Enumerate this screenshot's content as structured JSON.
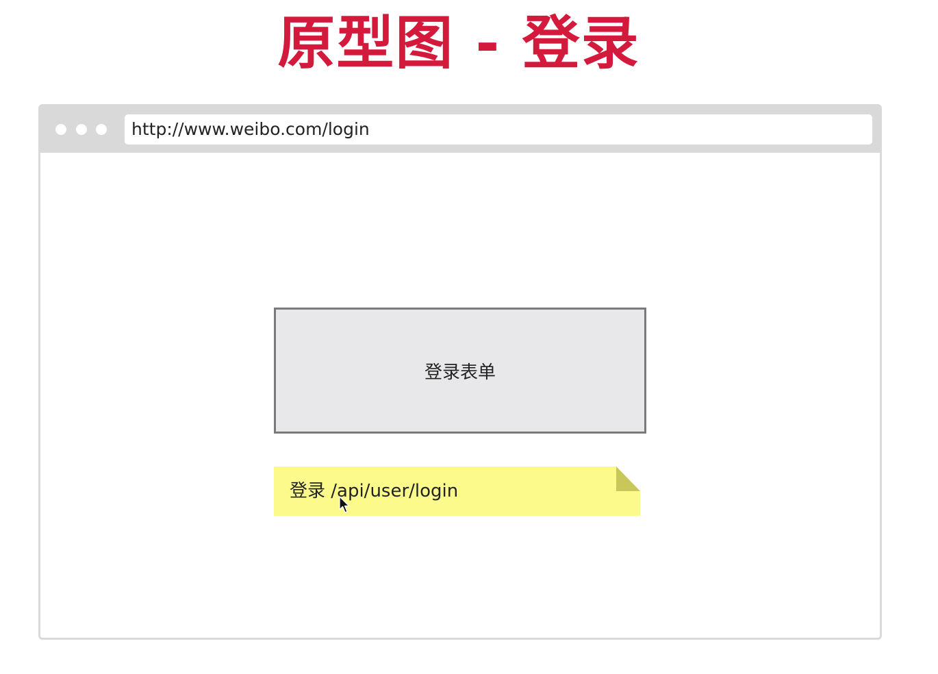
{
  "slide": {
    "title": "原型图 - 登录",
    "title_color": "#d41a3c"
  },
  "browser": {
    "url": "http://www.weibo.com/login",
    "window_dots": [
      "dot",
      "dot",
      "dot"
    ]
  },
  "main": {
    "form_box_label": "登录表单",
    "note": {
      "text": "登录 /api/user/login",
      "color": "#fbfa8b"
    }
  },
  "icons": {
    "cursor": "mouse-pointer-icon"
  }
}
